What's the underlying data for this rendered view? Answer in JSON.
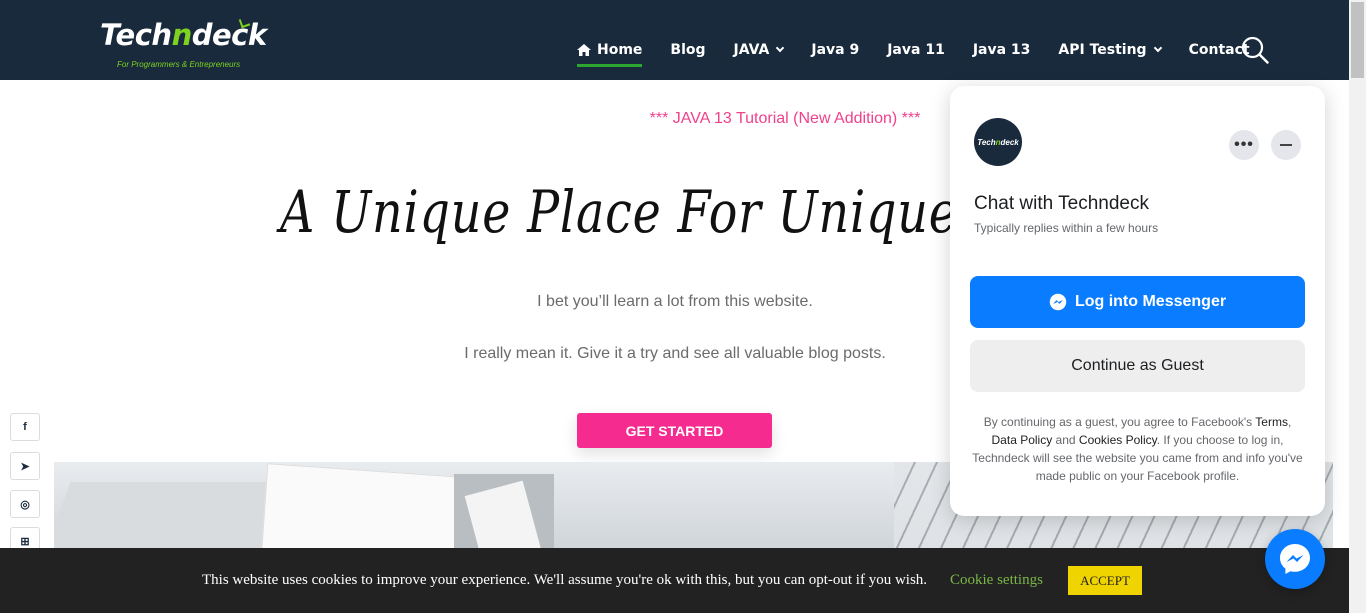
{
  "brand": {
    "name_prefix": "Tech",
    "name_accent": "n",
    "name_suffix": "deck",
    "tagline": "For Programmers & Entrepreneurs"
  },
  "nav": {
    "items": [
      {
        "label": "Home",
        "icon": "home-icon",
        "active": true
      },
      {
        "label": "Blog"
      },
      {
        "label": "JAVA",
        "dropdown": true
      },
      {
        "label": "Java 9"
      },
      {
        "label": "Java 11"
      },
      {
        "label": "Java 13"
      },
      {
        "label": "API Testing",
        "dropdown": true
      },
      {
        "label": "Contact"
      }
    ],
    "search_icon": "search-icon"
  },
  "hero": {
    "announcement": "*** JAVA 13 Tutorial (New Addition) ***",
    "headline": "A Unique Place For Unique Programmers",
    "sub1": "I bet you’ll learn a lot from this website.",
    "sub2": "I really mean it. Give it a try and see all valuable blog posts.",
    "cta_label": "GET STARTED"
  },
  "social": [
    {
      "icon": "facebook-icon",
      "glyph": "f"
    },
    {
      "icon": "twitter-icon",
      "glyph": "➤"
    },
    {
      "icon": "instagram-icon",
      "glyph": "◎"
    },
    {
      "icon": "teams-icon",
      "glyph": "⊞"
    }
  ],
  "cookie": {
    "text": "This website uses cookies to improve your experience. We'll assume you're ok with this, but you can opt-out if you wish.",
    "settings_label": "Cookie settings",
    "accept_label": "ACCEPT"
  },
  "chat": {
    "avatar_prefix": "Tech",
    "avatar_accent": "n",
    "avatar_suffix": "deck",
    "title": "Chat with Techndeck",
    "subtitle": "Typically replies within a few hours",
    "more_label": "•••",
    "messenger_label": "Log into Messenger",
    "guest_label": "Continue as Guest",
    "legal_1": "By continuing as a guest, you agree to Facebook's ",
    "legal_terms": "Terms",
    "legal_2": ", ",
    "legal_data": "Data Policy",
    "legal_3": " and ",
    "legal_cookies": "Cookies Policy",
    "legal_4": ". If you choose to log in, Techndeck will see the website you came from and info you've made public on your Facebook profile."
  },
  "colors": {
    "header_bg": "#192a3d",
    "accent_green": "#7ed321",
    "cta_pink": "#f52b8f",
    "announce_pink": "#f0418c",
    "messenger_blue": "#0a7cff",
    "cookie_accept": "#f0d400"
  }
}
